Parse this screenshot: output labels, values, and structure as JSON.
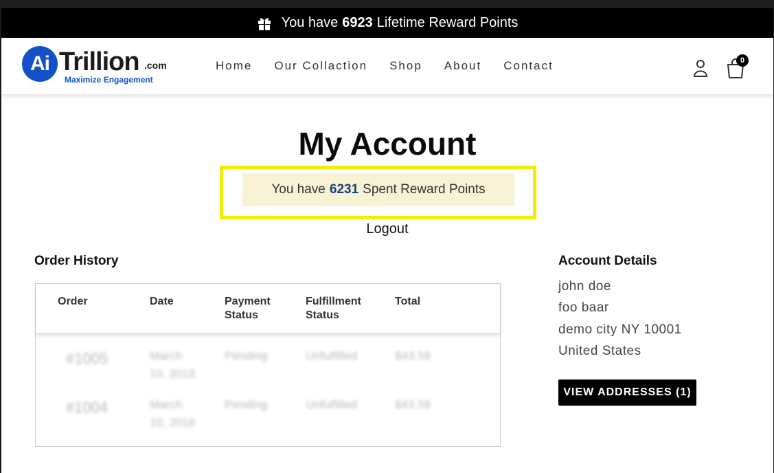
{
  "announcement": {
    "prefix": "You have",
    "points": "6923",
    "suffix": "Lifetime Reward Points",
    "icon": "gift-icon"
  },
  "header": {
    "logo": {
      "mark": "Ai",
      "brand": "Trillion",
      "tld": ".com",
      "tagline": "Maximize Engagement"
    },
    "nav": [
      "Home",
      "Our Collaction",
      "Shop",
      "About",
      "Contact"
    ],
    "account_icon": "user-icon",
    "cart_icon": "cart-icon",
    "cart_count": "0"
  },
  "page": {
    "title": "My Account",
    "reward": {
      "prefix": "You have",
      "points": "6231",
      "suffix": "Spent Reward Points"
    },
    "logout": "Logout"
  },
  "order_history": {
    "heading": "Order History",
    "columns": [
      "Order",
      "Date",
      "Payment Status",
      "Fulfillment Status",
      "Total"
    ],
    "rows": [
      {
        "order": "#1005",
        "date_line1": "March",
        "date_line2": "10, 2018",
        "payment": "Pending",
        "fulfillment": "Unfulfilled",
        "total": "$43.59"
      },
      {
        "order": "#1004",
        "date_line1": "March",
        "date_line2": "10, 2018",
        "payment": "Pending",
        "fulfillment": "Unfulfilled",
        "total": "$43.59"
      }
    ]
  },
  "account_details": {
    "heading": "Account Details",
    "name": "john doe",
    "company": "foo baar",
    "city_line": "demo city NY 10001",
    "country": "United States",
    "button": "VIEW ADDRESSES (1)"
  },
  "colors": {
    "announcement_bg": "#000000",
    "logo_blue": "#1351c8",
    "highlight": "#f3ee00",
    "note_bg": "#f6f2d3",
    "points_text": "#17407a"
  }
}
